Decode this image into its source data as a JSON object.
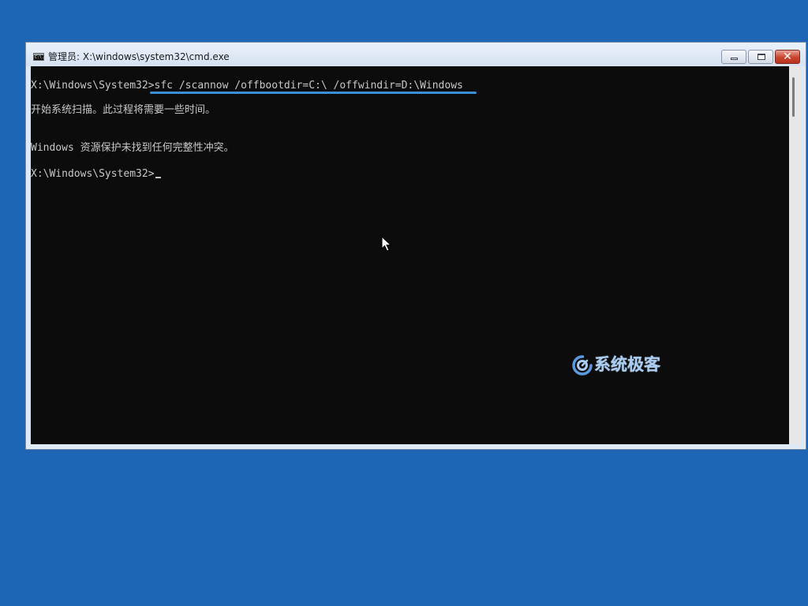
{
  "window": {
    "title": "管理员: X:\\windows\\system32\\cmd.exe",
    "icon": "cmd-icon",
    "icon_label": "C:\\."
  },
  "controls": {
    "minimize": "minimize-icon",
    "maximize": "maximize-icon",
    "close": "close-icon",
    "close_glyph": "✕"
  },
  "console": {
    "lines": [
      "X:\\Windows\\System32>sfc /scannow /offbootdir=C:\\ /offwindir=D:\\Windows",
      "开始系统扫描。此过程将需要一些时间。",
      "Windows 资源保护未找到任何完整性冲突。",
      "X:\\Windows\\System32>"
    ]
  },
  "watermark": {
    "text": "系统极客"
  },
  "colors": {
    "desktop": "#1f65b5",
    "console_bg": "#0c0c0c",
    "console_text": "#c8c8c8",
    "highlight": "#3b8fd9"
  }
}
